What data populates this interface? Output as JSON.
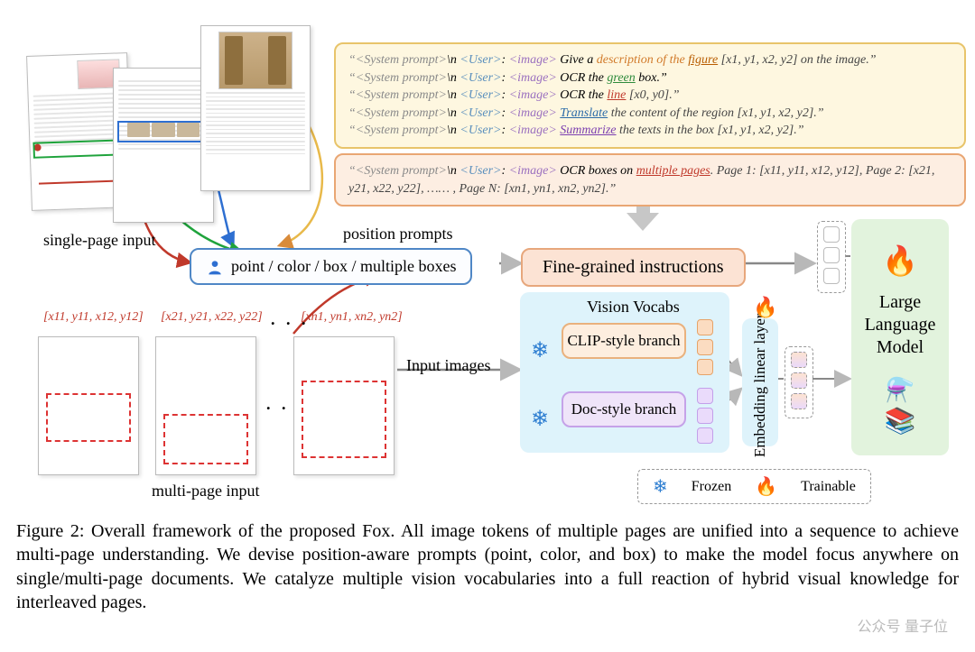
{
  "prompts": {
    "box1": {
      "l1_sys": "“<System prompt>",
      "l1_nl": "\\n ",
      "l1_user": "<User>",
      "l1_a": ": ",
      "l1_img": "<image>",
      "l1_b": " Give a ",
      "l1_desc": "description of the ",
      "l1_fig": "figure",
      "l1_c": " [x1, y1, x2, y2] on the image.”",
      "l2_sys": "“<System prompt>",
      "l2_nl": "\\n ",
      "l2_user": "<User>",
      "l2_a": ": ",
      "l2_img": "<image>",
      "l2_b": " OCR the ",
      "l2_green": "green",
      "l2_c": " box.”",
      "l3_sys": "“<System prompt>",
      "l3_nl": "\\n ",
      "l3_user": "<User>",
      "l3_a": ": ",
      "l3_img": "<image>",
      "l3_b": " OCR the ",
      "l3_line": "line",
      "l3_c": " [x0, y0].”",
      "l4_sys": "“<System prompt>",
      "l4_nl": "\\n ",
      "l4_user": "<User>",
      "l4_a": ": ",
      "l4_img": "<image>",
      "l4_b": " ",
      "l4_trans": "Translate",
      "l4_c": " the content of the region [x1, y1, x2, y2].”",
      "l5_sys": "“<System prompt>",
      "l5_nl": "\\n ",
      "l5_user": "<User>",
      "l5_a": ": ",
      "l5_img": "<image>",
      "l5_b": " ",
      "l5_summ": "Summarize",
      "l5_c": " the texts in the box [x1, y1, x2, y2].”"
    },
    "box2": {
      "sys": "“<System prompt>",
      "nl": "\\n ",
      "user": "<User>",
      "a": ": ",
      "img": "<image>",
      "b": " OCR boxes on ",
      "multi": "multiple pages",
      "c": ". Page 1: [x11, y11, x12, y12], Page 2: [x21, y21, x22, y22], …… , Page N: [xn1, yn1, xn2, yn2].”"
    }
  },
  "labels": {
    "single_page": "single-page input",
    "multi_page": "multi-page input",
    "position_prompts": "position prompts",
    "pill": "point / color / box / multiple boxes",
    "fine": "Fine-grained instructions",
    "input_images": "Input images",
    "vision_vocabs": "Vision Vocabs",
    "clip": "CLIP-style branch",
    "doc": "Doc-style branch",
    "embed": "Embedding linear layers",
    "llm": "Large Language Model",
    "frozen": "Frozen",
    "trainable": "Trainable"
  },
  "coords": {
    "c1": "[x11, y11, x12, y12]",
    "c2": "[x21, y21, x22, y22]",
    "c3": "[xn1, yn1, xn2, yn2]",
    "dots": ". . ."
  },
  "caption": "Figure 2: Overall framework of the proposed Fox. All image tokens of multiple pages are unified into a sequence to achieve multi-page understanding. We devise position-aware prompts (point, color, and box) to make the model focus anywhere on single/multi-page documents. We catalyze multiple vision vocabularies into a full reaction of hybrid visual knowledge for interleaved pages.",
  "watermark": "公众号  量子位"
}
